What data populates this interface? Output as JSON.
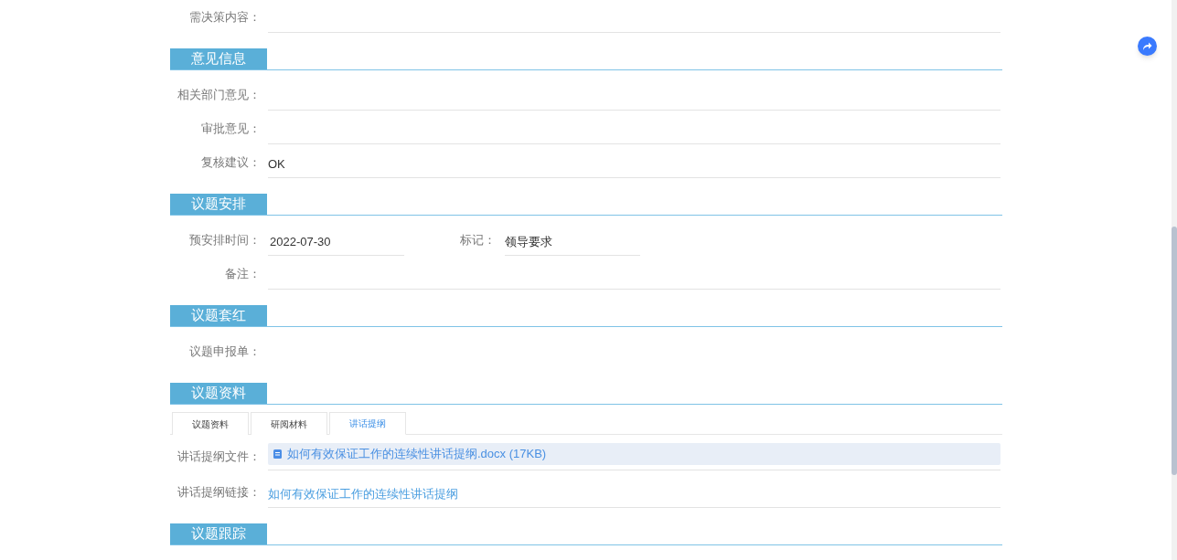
{
  "leading_fields": [
    {
      "kind": "field",
      "label": "需决策内容："
    }
  ],
  "sections": [
    {
      "title": "意见信息",
      "rows": [
        {
          "kind": "field",
          "label": "相关部门意见："
        },
        {
          "kind": "field",
          "label": "审批意见："
        },
        {
          "kind": "field",
          "label": "复核建议：",
          "value": "OK"
        }
      ]
    },
    {
      "title": "议题安排",
      "rows": [
        {
          "kind": "pair",
          "label": "预安排时间：",
          "value": "2022-07-30",
          "label_2": "标记：",
          "value_2": "领导要求"
        },
        {
          "kind": "field",
          "label": "备注："
        }
      ]
    },
    {
      "title": "议题套红",
      "rows": [
        {
          "kind": "bare",
          "label": "议题申报单："
        }
      ]
    },
    {
      "title": "议题资料",
      "tabs": [
        {
          "label": "议题资料",
          "selected": false
        },
        {
          "label": "研阅材料",
          "selected": false
        },
        {
          "label": "讲话提纲",
          "selected": true
        }
      ],
      "rows": [
        {
          "kind": "file",
          "label": "讲话提纲文件：",
          "value": "如何有效保证工作的连续性讲话提纲.docx (17KB)"
        },
        {
          "kind": "link",
          "label": "讲话提纲链接：",
          "value": "如何有效保证工作的连续性讲话提纲"
        }
      ]
    },
    {
      "title": "议题跟踪"
    }
  ]
}
